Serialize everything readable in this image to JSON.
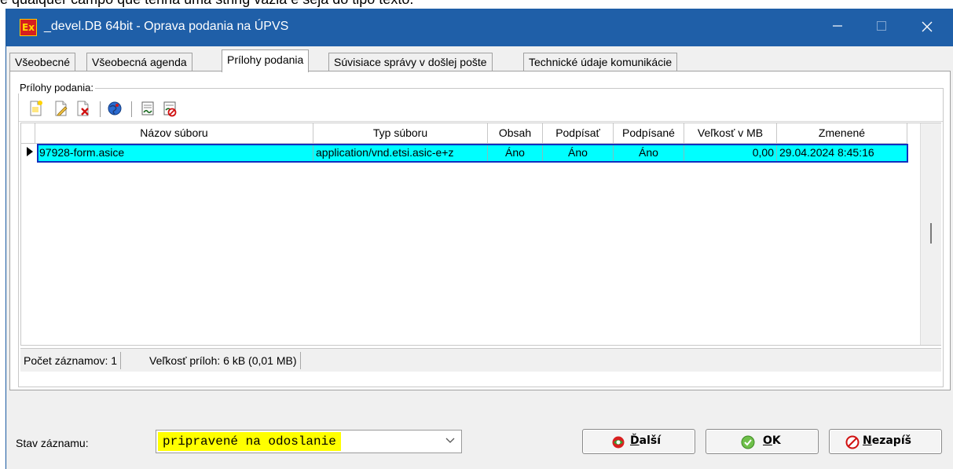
{
  "window": {
    "title": "_devel.DB 64bit - Oprava podania na ÚPVS",
    "app_icon_text": "Ex"
  },
  "top_strip_text": "e qualquer campo que tenha uma string vazia e seja do tipo texto.",
  "tabs": [
    {
      "label": "Všeobecné",
      "active": false
    },
    {
      "label": "Všeobecná agenda",
      "active": false
    },
    {
      "label": "Prílohy podania",
      "active": true
    },
    {
      "label": "Súvisiace správy v došlej pošte",
      "active": false
    },
    {
      "label": "Technické údaje komunikácie",
      "active": false
    }
  ],
  "attachments": {
    "group_label": "Prílohy podania:",
    "toolbar": [
      {
        "icon": "new-document-icon"
      },
      {
        "icon": "edit-document-icon"
      },
      {
        "icon": "delete-document-icon"
      },
      {
        "icon": "globe-icon"
      },
      {
        "icon": "sign-icon"
      },
      {
        "icon": "remove-signature-icon"
      }
    ],
    "columns": [
      "Názov súboru",
      "Typ súboru",
      "Obsah",
      "Podpísať",
      "Podpísané",
      "Veľkosť v MB",
      "Zmenené"
    ],
    "rows": [
      {
        "name": "97928-form.asice",
        "type": "application/vnd.etsi.asic-e+z",
        "content": "Áno",
        "sign": "Áno",
        "signed": "Áno",
        "size_mb": "0,00",
        "modified": "29.04.2024 8:45:16"
      }
    ],
    "status": {
      "count": "Počet záznamov: 1",
      "size": "Veľkosť príloh: 6 kB (0,01 MB)"
    }
  },
  "footer": {
    "record_state_label": "Stav záznamu:",
    "record_state_value": "pripravené na odoslanie",
    "buttons": {
      "next": {
        "pre": "",
        "accel": "Ď",
        "post": "alší"
      },
      "ok": {
        "pre": "",
        "accel": "O",
        "post": "K"
      },
      "cancel": {
        "pre": "",
        "accel": "N",
        "post": "ezapíš"
      }
    }
  },
  "colors": {
    "titlebar": "#1f5fa8",
    "selected_row": "#00ffff",
    "state_highlight": "#ffff00"
  }
}
